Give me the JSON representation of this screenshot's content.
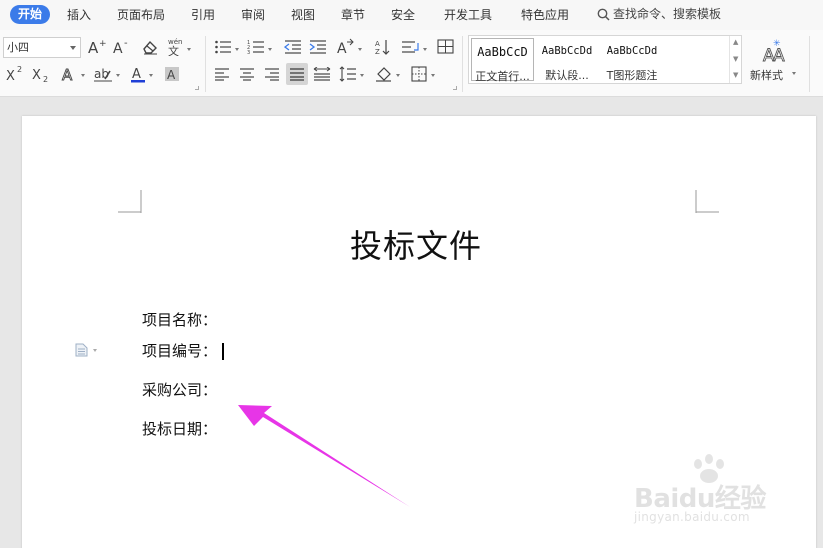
{
  "menu": {
    "tabs": [
      "开始",
      "插入",
      "页面布局",
      "引用",
      "审阅",
      "视图",
      "章节",
      "安全",
      "开发工具",
      "特色应用"
    ],
    "active_tab": "开始",
    "search_label": "查找命令、搜索模板"
  },
  "ribbon": {
    "font_size": "小四",
    "styles": [
      {
        "sample": "AaBbCcD",
        "name": "正文首行..."
      },
      {
        "sample": "AaBbCcDd",
        "name": "默认段..."
      },
      {
        "sample": "AaBbCcDd",
        "name": "T图形题注"
      }
    ],
    "new_style_label": "新样式",
    "font_color": "#1f3fd6",
    "highlight_color": "#c8c8c8"
  },
  "document": {
    "title": "投标文件",
    "lines": [
      "项目名称：",
      "项目编号：",
      "采购公司：",
      "投标日期："
    ]
  },
  "annotation": {
    "arrow_color": "#e735e7"
  },
  "watermark": {
    "brand": "Baidu经验",
    "url": "jingyan.baidu.com"
  }
}
